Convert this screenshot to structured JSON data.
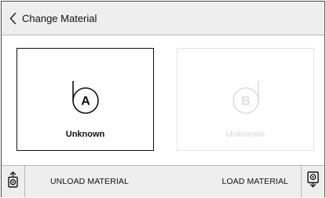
{
  "header": {
    "back_icon": "chevron-left-icon",
    "title": "Change Material"
  },
  "materials": [
    {
      "slot": "A",
      "status": "Unknown",
      "state": "selected",
      "icon": "spool-a-icon"
    },
    {
      "slot": "B",
      "status": "Unknown",
      "state": "disabled",
      "icon": "spool-b-icon"
    }
  ],
  "footer": {
    "unload_icon": "unload-material-icon",
    "unload_label": "UNLOAD MATERIAL",
    "load_label": "LOAD MATERIAL",
    "load_icon": "load-material-icon"
  },
  "colors": {
    "header_bg": "#eeeeee",
    "footer_bg": "#eeeeee",
    "selected_border": "#111111",
    "disabled": "#e2e2e2",
    "text": "#111111"
  }
}
